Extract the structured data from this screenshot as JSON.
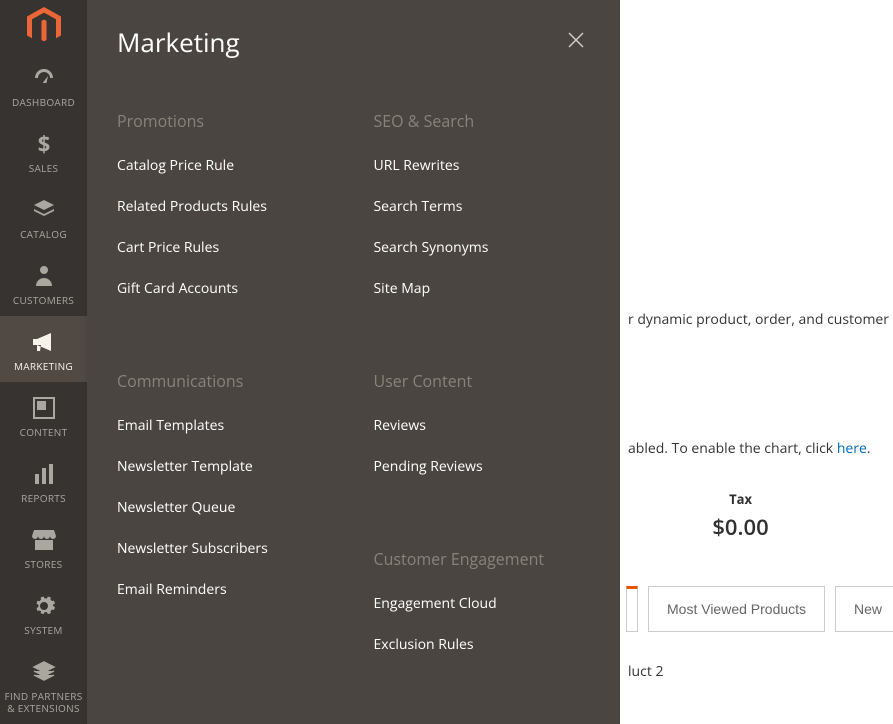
{
  "sidebar": {
    "items": [
      {
        "label": "DASHBOARD",
        "icon": "dashboard-icon"
      },
      {
        "label": "SALES",
        "icon": "dollar-icon"
      },
      {
        "label": "CATALOG",
        "icon": "catalog-icon"
      },
      {
        "label": "CUSTOMERS",
        "icon": "customers-icon"
      },
      {
        "label": "MARKETING",
        "icon": "marketing-icon",
        "active": true
      },
      {
        "label": "CONTENT",
        "icon": "content-icon"
      },
      {
        "label": "REPORTS",
        "icon": "reports-icon"
      },
      {
        "label": "STORES",
        "icon": "stores-icon"
      },
      {
        "label": "SYSTEM",
        "icon": "system-icon"
      },
      {
        "label": "FIND PARTNERS & EXTENSIONS",
        "icon": "partners-icon"
      }
    ]
  },
  "flyout": {
    "title": "Marketing",
    "sections": {
      "promotions": {
        "title": "Promotions",
        "links": [
          "Catalog Price Rule",
          "Related Products Rules",
          "Cart Price Rules",
          "Gift Card Accounts"
        ]
      },
      "communications": {
        "title": "Communications",
        "links": [
          "Email Templates",
          "Newsletter Template",
          "Newsletter Queue",
          "Newsletter Subscribers",
          "Email Reminders"
        ]
      },
      "seo": {
        "title": "SEO & Search",
        "links": [
          "URL Rewrites",
          "Search Terms",
          "Search Synonyms",
          "Site Map"
        ]
      },
      "user_content": {
        "title": "User Content",
        "links": [
          "Reviews",
          "Pending Reviews"
        ]
      },
      "engagement": {
        "title": "Customer Engagement",
        "links": [
          "Engagement Cloud",
          "Exclusion Rules"
        ]
      }
    }
  },
  "main": {
    "partial_text_1": "r dynamic product, order, and customer",
    "hint_prefix": "abled. To enable the chart, click ",
    "hint_link": "here",
    "hint_suffix": ".",
    "tax_label": "Tax",
    "tax_amount": "$0.00",
    "tabs": [
      "Most Viewed Products",
      "New"
    ],
    "bg_row": "luct 2"
  }
}
